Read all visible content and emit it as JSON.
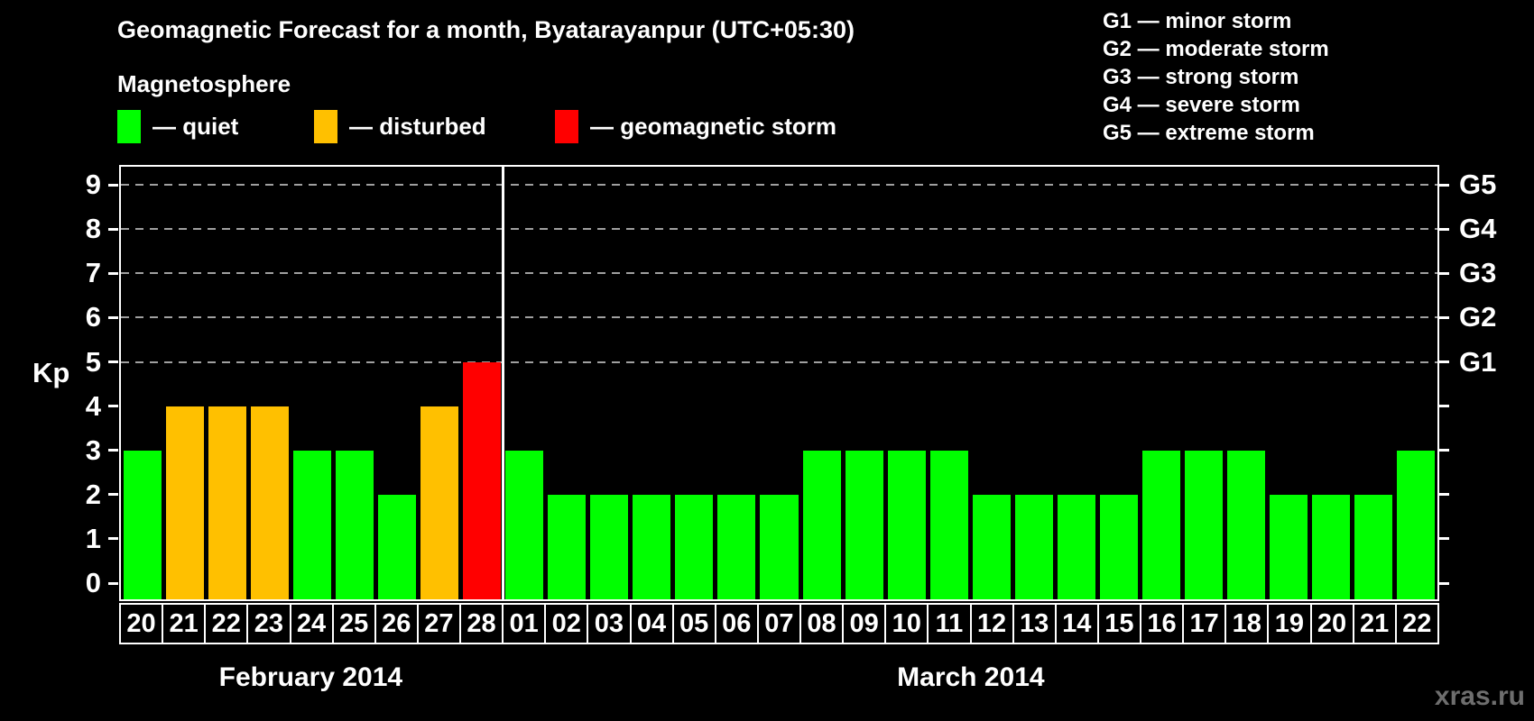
{
  "title": "Geomagnetic Forecast for a month, Byatarayanpur (UTC+05:30)",
  "subtitle": "Magnetosphere",
  "colors": {
    "quiet": "#00ff00",
    "disturbed": "#ffc000",
    "storm": "#ff0000",
    "background": "#000000",
    "frame": "#ffffff",
    "gridline": "#a0a0a0",
    "watermark": "#6e6e6e"
  },
  "legend": {
    "items": [
      {
        "status": "quiet",
        "label": "— quiet",
        "color": "#00ff00"
      },
      {
        "status": "disturbed",
        "label": "— disturbed",
        "color": "#ffc000"
      },
      {
        "status": "storm",
        "label": "— geomagnetic storm",
        "color": "#ff0000"
      }
    ]
  },
  "g_legend": {
    "lines": [
      "G1 — minor storm",
      "G2 — moderate storm",
      "G3 — strong storm",
      "G4 — severe storm",
      "G5 — extreme storm"
    ]
  },
  "y_axis": {
    "label": "Kp",
    "ticks": [
      0,
      1,
      2,
      3,
      4,
      5,
      6,
      7,
      8,
      9
    ]
  },
  "right_axis": {
    "labels": [
      {
        "kp": 5,
        "label": "G1"
      },
      {
        "kp": 6,
        "label": "G2"
      },
      {
        "kp": 7,
        "label": "G3"
      },
      {
        "kp": 8,
        "label": "G4"
      },
      {
        "kp": 9,
        "label": "G5"
      }
    ]
  },
  "watermark": "xras.ru",
  "chart_data": {
    "type": "bar",
    "title": "Geomagnetic Forecast for a month, Byatarayanpur (UTC+05:30)",
    "xlabel": "",
    "ylabel": "Kp",
    "ylim": [
      0,
      9
    ],
    "grid": "dashed horizontal at Kp 5-9 (G1-G5)",
    "gridlines_kp": [
      5,
      6,
      7,
      8,
      9
    ],
    "legend_position": "top",
    "months": [
      {
        "label": "February 2014",
        "days": 9
      },
      {
        "label": "March 2014",
        "days": 22
      }
    ],
    "categories": [
      "20",
      "21",
      "22",
      "23",
      "24",
      "25",
      "26",
      "27",
      "28",
      "01",
      "02",
      "03",
      "04",
      "05",
      "06",
      "07",
      "08",
      "09",
      "10",
      "11",
      "12",
      "13",
      "14",
      "15",
      "16",
      "17",
      "18",
      "19",
      "20",
      "21",
      "22"
    ],
    "values": [
      3,
      4,
      4,
      4,
      3,
      3,
      2,
      4,
      5,
      3,
      2,
      2,
      2,
      2,
      2,
      2,
      3,
      3,
      3,
      3,
      2,
      2,
      2,
      2,
      3,
      3,
      3,
      2,
      2,
      2,
      3
    ],
    "statuses": [
      "quiet",
      "disturbed",
      "disturbed",
      "disturbed",
      "quiet",
      "quiet",
      "quiet",
      "disturbed",
      "storm",
      "quiet",
      "quiet",
      "quiet",
      "quiet",
      "quiet",
      "quiet",
      "quiet",
      "quiet",
      "quiet",
      "quiet",
      "quiet",
      "quiet",
      "quiet",
      "quiet",
      "quiet",
      "quiet",
      "quiet",
      "quiet",
      "quiet",
      "quiet",
      "quiet",
      "quiet"
    ]
  }
}
